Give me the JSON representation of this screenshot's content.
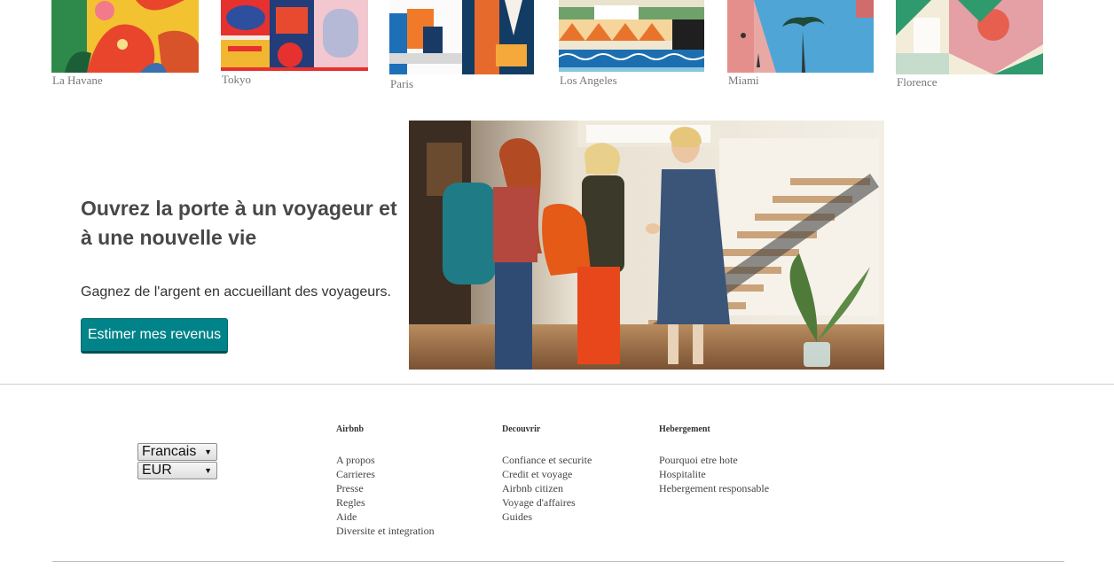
{
  "cities": [
    {
      "name": "La Havane"
    },
    {
      "name": "Tokyo"
    },
    {
      "name": "Paris"
    },
    {
      "name": "Los Angeles"
    },
    {
      "name": "Miami"
    },
    {
      "name": "Florence"
    }
  ],
  "hero": {
    "title": "Ouvrez la porte à un voyageur et à une nouvelle vie",
    "text": "Gagnez de l'argent en accueillant des voyageurs.",
    "button": "Estimer mes revenus",
    "button_color": "#008489"
  },
  "footer": {
    "language": {
      "value": "Francais",
      "icon": "dropdown-arrow-icon"
    },
    "currency": {
      "value": "EUR",
      "icon": "dropdown-arrow-icon"
    },
    "columns": [
      {
        "title": "Airbnb",
        "links": [
          "A propos",
          "Carrieres",
          "Presse",
          "Regles",
          "Aide",
          "Diversite et integration"
        ]
      },
      {
        "title": "Decouvrir",
        "links": [
          "Confiance et securite",
          "Credit et voyage",
          "Airbnb citizen",
          "Voyage d'affaires",
          "Guides"
        ]
      },
      {
        "title": "Hebergement",
        "links": [
          "Pourquoi etre hote",
          "Hospitalite",
          "Hebergement responsable"
        ]
      }
    ]
  }
}
